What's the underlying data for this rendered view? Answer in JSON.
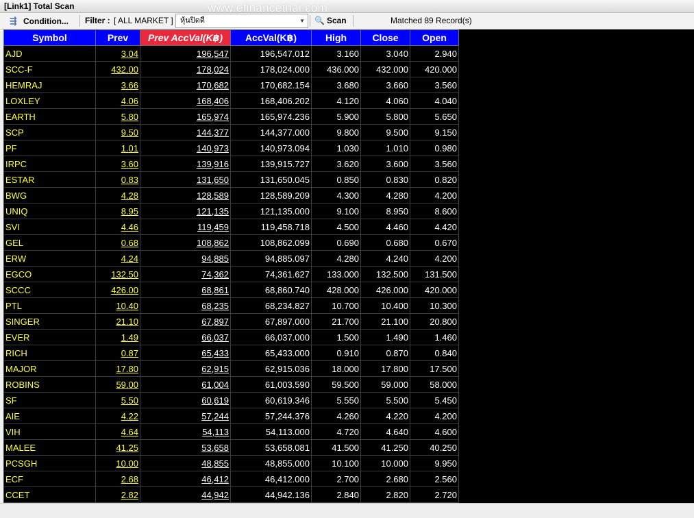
{
  "window": {
    "title": "[Link1] Total Scan"
  },
  "watermark": "www.efinancethai.com",
  "toolbar": {
    "condition_label": "Condition...",
    "filter_label": "Filter :",
    "filter_value": "[ ALL MARKET ]",
    "combo_value": "หุ้นปิดดี",
    "scan_label": "Scan",
    "matched_text": "Matched 89 Record(s)"
  },
  "columns": [
    "Symbol",
    "Prev",
    "Prev AccVal(K฿)",
    "AccVal(K฿)",
    "High",
    "Close",
    "Open"
  ],
  "sorted_column_index": 2,
  "colors": {
    "header_bg": "#0000ff",
    "sorted_header_bg": "#e8283c",
    "symbol_text": "#ffff33",
    "value_text": "#ffffff",
    "grid_bg": "#000000"
  },
  "rows": [
    [
      "AJD",
      "3.04",
      "196,547",
      "196,547.012",
      "3.160",
      "3.040",
      "2.940"
    ],
    [
      "SCC-F",
      "432.00",
      "178,024",
      "178,024.000",
      "436.000",
      "432.000",
      "420.000"
    ],
    [
      "HEMRAJ",
      "3.66",
      "170,682",
      "170,682.154",
      "3.680",
      "3.660",
      "3.560"
    ],
    [
      "LOXLEY",
      "4.06",
      "168,406",
      "168,406.202",
      "4.120",
      "4.060",
      "4.040"
    ],
    [
      "EARTH",
      "5.80",
      "165,974",
      "165,974.236",
      "5.900",
      "5.800",
      "5.650"
    ],
    [
      "SCP",
      "9.50",
      "144,377",
      "144,377.000",
      "9.800",
      "9.500",
      "9.150"
    ],
    [
      "PF",
      "1.01",
      "140,973",
      "140,973.094",
      "1.030",
      "1.010",
      "0.980"
    ],
    [
      "IRPC",
      "3.60",
      "139,916",
      "139,915.727",
      "3.620",
      "3.600",
      "3.560"
    ],
    [
      "ESTAR",
      "0.83",
      "131,650",
      "131,650.045",
      "0.850",
      "0.830",
      "0.820"
    ],
    [
      "BWG",
      "4.28",
      "128,589",
      "128,589.209",
      "4.300",
      "4.280",
      "4.200"
    ],
    [
      "UNIQ",
      "8.95",
      "121,135",
      "121,135.000",
      "9.100",
      "8.950",
      "8.600"
    ],
    [
      "SVI",
      "4.46",
      "119,459",
      "119,458.718",
      "4.500",
      "4.460",
      "4.420"
    ],
    [
      "GEL",
      "0.68",
      "108,862",
      "108,862.099",
      "0.690",
      "0.680",
      "0.670"
    ],
    [
      "ERW",
      "4.24",
      "94,885",
      "94,885.097",
      "4.280",
      "4.240",
      "4.200"
    ],
    [
      "EGCO",
      "132.50",
      "74,362",
      "74,361.627",
      "133.000",
      "132.500",
      "131.500"
    ],
    [
      "SCCC",
      "426.00",
      "68,861",
      "68,860.740",
      "428.000",
      "426.000",
      "420.000"
    ],
    [
      "PTL",
      "10.40",
      "68,235",
      "68,234.827",
      "10.700",
      "10.400",
      "10.300"
    ],
    [
      "SINGER",
      "21.10",
      "67,897",
      "67,897.000",
      "21.700",
      "21.100",
      "20.800"
    ],
    [
      "EVER",
      "1.49",
      "66,037",
      "66,037.000",
      "1.500",
      "1.490",
      "1.460"
    ],
    [
      "RICH",
      "0.87",
      "65,433",
      "65,433.000",
      "0.910",
      "0.870",
      "0.840"
    ],
    [
      "MAJOR",
      "17.80",
      "62,915",
      "62,915.036",
      "18.000",
      "17.800",
      "17.500"
    ],
    [
      "ROBINS",
      "59.00",
      "61,004",
      "61,003.590",
      "59.500",
      "59.000",
      "58.000"
    ],
    [
      "SF",
      "5.50",
      "60,619",
      "60,619.346",
      "5.550",
      "5.500",
      "5.450"
    ],
    [
      "AIE",
      "4.22",
      "57,244",
      "57,244.376",
      "4.260",
      "4.220",
      "4.200"
    ],
    [
      "VIH",
      "4.64",
      "54,113",
      "54,113.000",
      "4.720",
      "4.640",
      "4.600"
    ],
    [
      "MALEE",
      "41.25",
      "53,658",
      "53,658.081",
      "41.500",
      "41.250",
      "40.250"
    ],
    [
      "PCSGH",
      "10.00",
      "48,855",
      "48,855.000",
      "10.100",
      "10.000",
      "9.950"
    ],
    [
      "ECF",
      "2.68",
      "46,412",
      "46,412.000",
      "2.700",
      "2.680",
      "2.560"
    ],
    [
      "CCET",
      "2.82",
      "44,942",
      "44,942.136",
      "2.840",
      "2.820",
      "2.720"
    ]
  ]
}
